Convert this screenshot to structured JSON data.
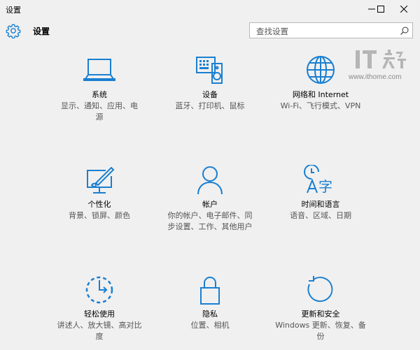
{
  "window": {
    "title": "设置",
    "controls": [
      "minimize-icon",
      "maximize-icon",
      "close-icon"
    ]
  },
  "header": {
    "app_title": "设置",
    "search_placeholder": "查找设置"
  },
  "watermark": {
    "logo_text": "IT之家",
    "url": "www.ithome.com"
  },
  "colors": {
    "accent": "#1a7fd1",
    "background": "#f0f0f0",
    "description_text": "#555555"
  },
  "categories": [
    {
      "name": "系统",
      "description": "显示、通知、应用、电源",
      "icon": "laptop-icon"
    },
    {
      "name": "设备",
      "description": "蓝牙、打印机、鼠标",
      "icon": "devices-icon"
    },
    {
      "name": "网络和 Internet",
      "description": "Wi-Fi、飞行模式、VPN",
      "icon": "globe-icon"
    },
    {
      "name": "个性化",
      "description": "背景、锁屏、颜色",
      "icon": "personalization-icon"
    },
    {
      "name": "帐户",
      "description": "你的帐户、电子邮件、同步设置、工作、其他用户",
      "icon": "person-icon"
    },
    {
      "name": "时间和语言",
      "description": "语音、区域、日期",
      "icon": "time-language-icon"
    },
    {
      "name": "轻松使用",
      "description": "讲述人、放大镜、高对比度",
      "icon": "ease-of-access-icon"
    },
    {
      "name": "隐私",
      "description": "位置、相机",
      "icon": "lock-icon"
    },
    {
      "name": "更新和安全",
      "description": "Windows 更新、恢复、备份",
      "icon": "update-icon"
    }
  ]
}
